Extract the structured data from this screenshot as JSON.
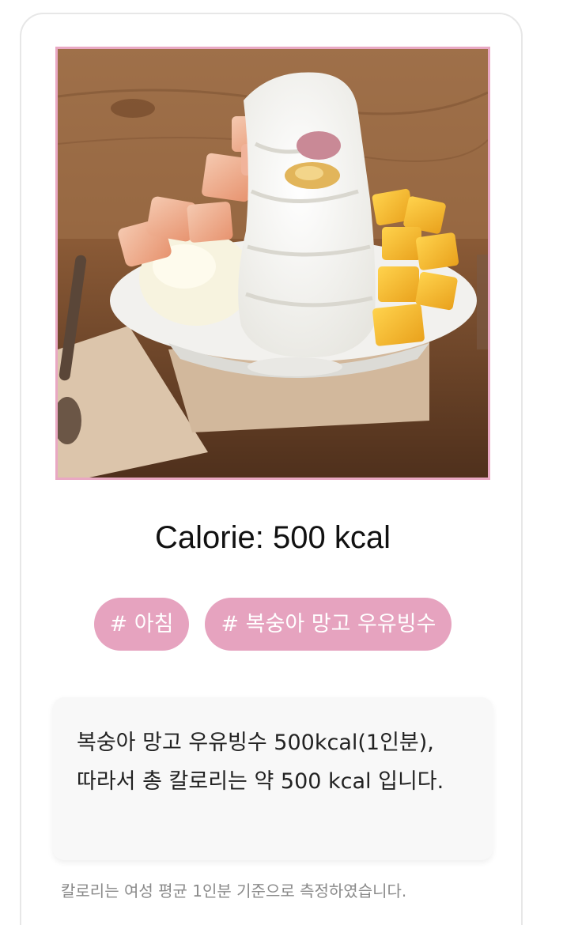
{
  "photo": {
    "alt_icon": "food-photo-bingsu",
    "frame_color": "#e9a8c3"
  },
  "result": {
    "calorie_text": "Calorie: 500 kcal"
  },
  "tags": [
    {
      "label": "# 아침"
    },
    {
      "label": "# 복숭아 망고 우유빙수"
    }
  ],
  "description": {
    "text": "복숭아 망고 우유빙수 500kcal(1인분), 따라서 총 칼로리는 약 500 kcal 입니다."
  },
  "footnote": {
    "text": "칼로리는 여성 평균 1인분 기준으로 측정하였습니다."
  },
  "colors": {
    "accent_pink": "#e6a3bf",
    "card_border": "#e7e7e7",
    "box_bg": "#f8f8f8"
  }
}
